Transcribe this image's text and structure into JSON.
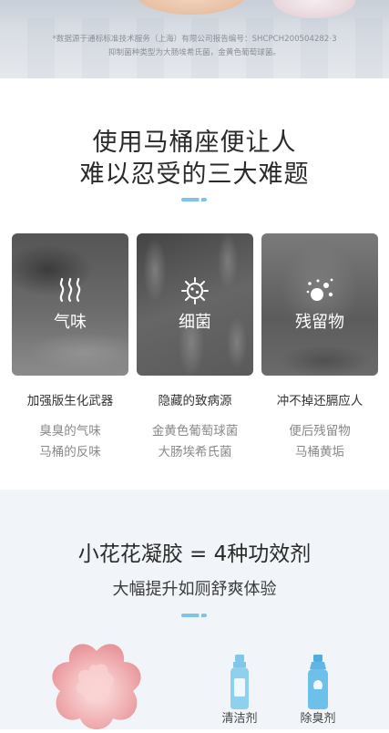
{
  "footnote": {
    "line1": "*数据源于通标标准技术服务（上海）有限公司报告编号：SHCPCH200504282·3",
    "line2": "抑制菌种类型为大肠埃希氏菌，金黄色葡萄球菌。"
  },
  "section1": {
    "title_line1": "使用马桶座便让人",
    "title_line2": "难以忍受的三大难题",
    "cards": [
      {
        "icon": "odor-waves-icon",
        "image_label": "气味",
        "heading": "加强版生化武器",
        "sub1": "臭臭的气味",
        "sub2": "马桶的反味"
      },
      {
        "icon": "germ-icon",
        "image_label": "细菌",
        "heading": "隐藏的致病源",
        "sub1": "金黄色葡萄球菌",
        "sub2": "大肠埃希氏菌"
      },
      {
        "icon": "residue-particles-icon",
        "image_label": "残留物",
        "heading": "冲不掉还膈应人",
        "sub1": "便后残留物",
        "sub2": "马桶黄垢"
      }
    ]
  },
  "section2": {
    "title": "小花花凝胶 = 4种功效剂",
    "subtitle": "大幅提升如厕舒爽体验",
    "items": [
      {
        "icon": "cleaner-bottle-icon",
        "label": "清洁剂",
        "color": "#7fc6e8"
      },
      {
        "icon": "deodorant-bottle-icon",
        "label": "除臭剂",
        "color": "#5fb6e2"
      }
    ]
  },
  "colors": {
    "accent": "#7fc3e6",
    "section2_bg": "#f1f5f9",
    "flower_pink": "#f2b6b8"
  }
}
